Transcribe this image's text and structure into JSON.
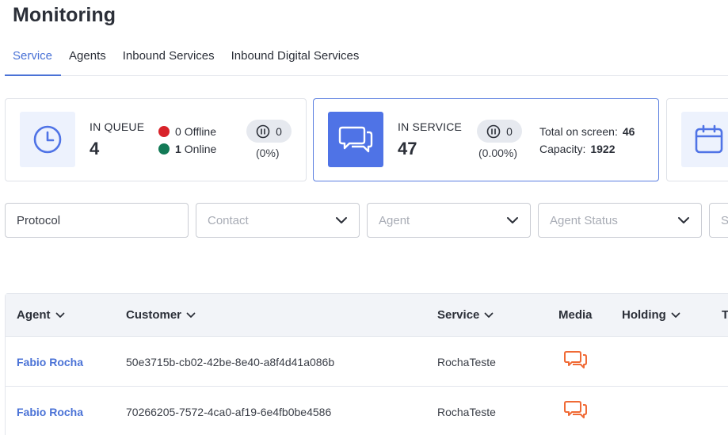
{
  "page": {
    "title": "Monitoring"
  },
  "tabs": [
    {
      "label": "Service",
      "active": true
    },
    {
      "label": "Agents",
      "active": false
    },
    {
      "label": "Inbound Services",
      "active": false
    },
    {
      "label": "Inbound Digital Services",
      "active": false
    }
  ],
  "queue_card": {
    "label": "IN QUEUE",
    "value": "4",
    "offline_count": "0",
    "offline_label": "Offline",
    "online_count": "1",
    "online_label": "Online",
    "paused_count": "0",
    "paused_pct": "(0%)",
    "icon": "clock-icon"
  },
  "service_card": {
    "label": "IN SERVICE",
    "value": "47",
    "paused_count": "0",
    "paused_pct": "(0.00%)",
    "total_on_screen_label": "Total on screen:",
    "total_on_screen_value": "46",
    "capacity_label": "Capacity:",
    "capacity_value": "1922",
    "icon": "chat-icon"
  },
  "third_card": {
    "icon": "calendar-icon"
  },
  "filters": {
    "protocol": "Protocol",
    "contact": "Contact",
    "agent": "Agent",
    "agent_status": "Agent Status",
    "fifth": "S"
  },
  "table": {
    "columns": [
      "Agent",
      "Customer",
      "Service",
      "Media",
      "Holding",
      "T"
    ],
    "rows": [
      {
        "agent": "Fabio Rocha",
        "customer": "50e3715b-cb02-42be-8e40-a8f4d41a086b",
        "service": "RochaTeste",
        "media": "chat-icon"
      },
      {
        "agent": "Fabio Rocha",
        "customer": "70266205-7572-4ca0-af19-6e4fb0be4586",
        "service": "RochaTeste",
        "media": "chat-icon"
      }
    ]
  },
  "colors": {
    "accent": "#4a72d6",
    "icon_blue": "#4f73e6",
    "offline_dot": "#d8232a",
    "online_dot": "#137a56",
    "media_orange": "#f06a35"
  }
}
